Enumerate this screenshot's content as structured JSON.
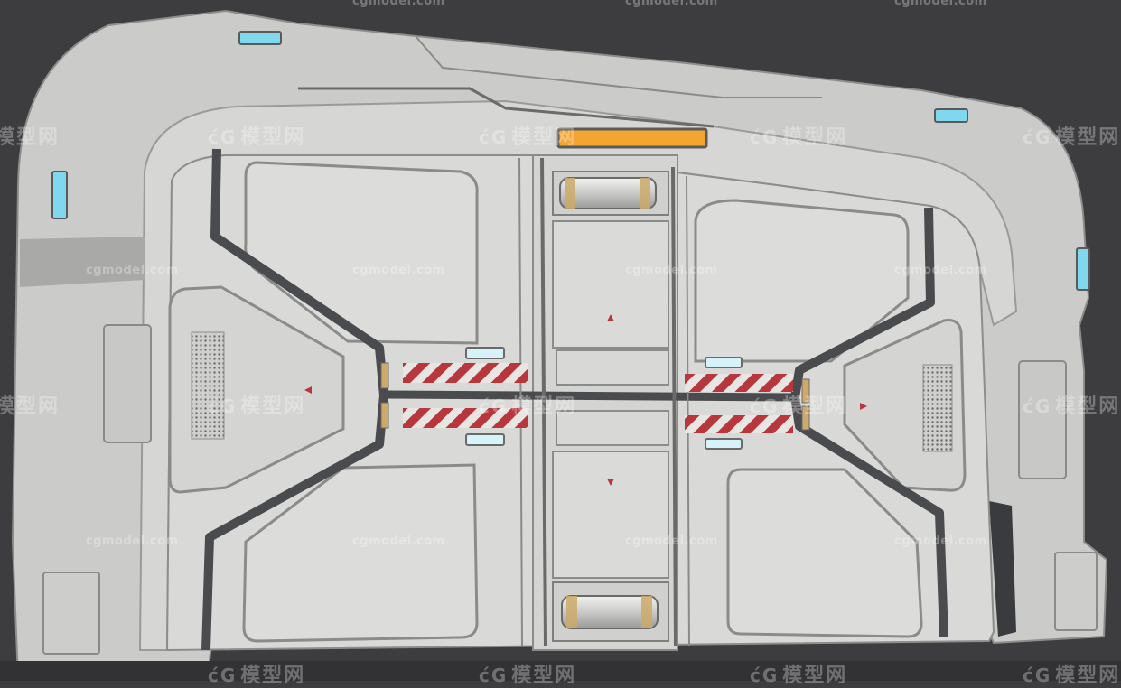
{
  "scene": {
    "subject": "sci-fi-door-3d-render",
    "colors": {
      "background": "#3d3d3f",
      "panel": "#d8d8d6",
      "panel_light": "#e2e2e0",
      "panel_shadow": "#a6a6a4",
      "frame": "#cfcfcd",
      "seam": "#4a4b4e",
      "light_blue": "#7fd8ee",
      "light_orange": "#f2a531",
      "hazard_red": "#b8373c",
      "brass": "#cdaa6a"
    }
  },
  "watermarks": {
    "cn_logo": "ćG",
    "cn_text": "模型网",
    "en_text": "cgmodel.com"
  }
}
